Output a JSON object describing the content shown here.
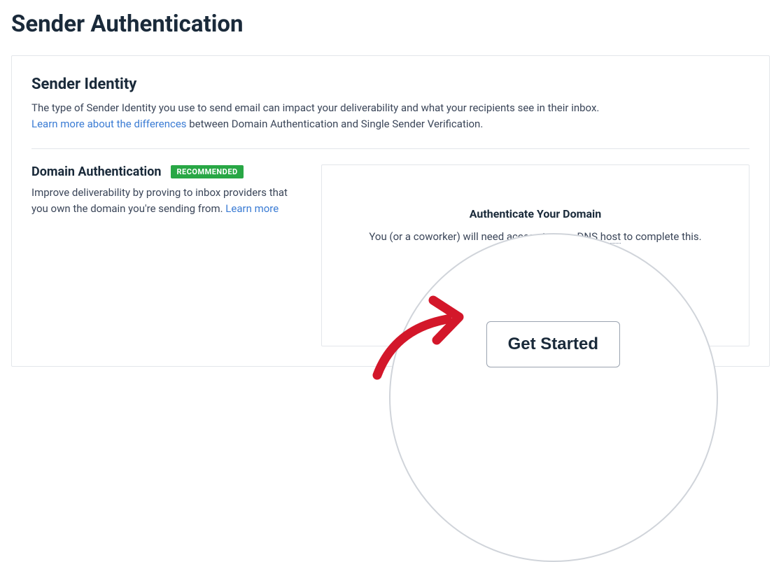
{
  "pageTitle": "Sender Authentication",
  "senderIdentity": {
    "title": "Sender Identity",
    "desc1": "The type of Sender Identity you use to send email can impact your deliverability and what your recipients see in their inbox.",
    "linkText": "Learn more about the differences",
    "desc2": " between Domain Authentication and Single Sender Verification."
  },
  "domainAuth": {
    "title": "Domain Authentication",
    "badge": "RECOMMENDED",
    "desc1": "Improve deliverability by proving to inbox providers that you own the domain you're sending from. ",
    "learnMore": "Learn more"
  },
  "rightPanel": {
    "title": "Authenticate Your Domain",
    "descPre": "You (or a coworker) will need access to your ",
    "dnsTerm": "DNS host",
    "descPost": " to complete this.",
    "buttonLabel": "Get Started"
  }
}
